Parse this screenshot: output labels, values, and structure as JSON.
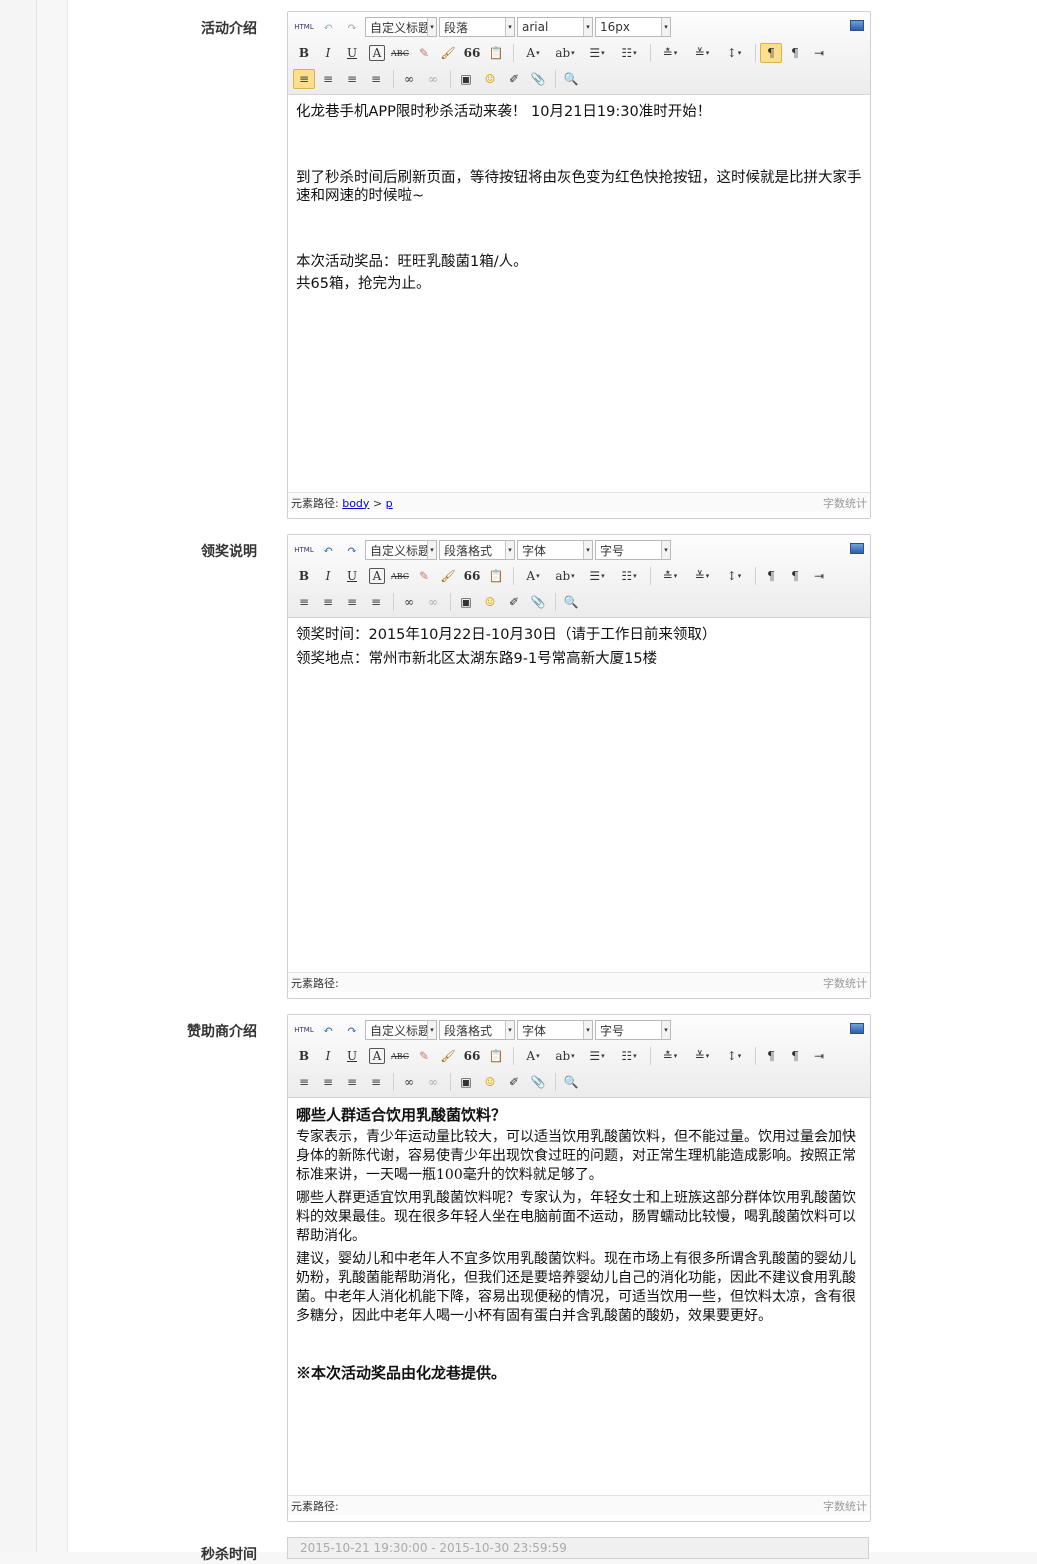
{
  "toolbar": {
    "html_label": "HTML",
    "bold": "B",
    "italic": "I",
    "underline": "U",
    "fontborder": "A",
    "strike": "ABC",
    "forecolor": "A",
    "blockquote": "66",
    "zoom_icon": "search-icon"
  },
  "editors": [
    {
      "label": "活动介绍",
      "combo_heading": "自定义标题",
      "combo_para": "段落",
      "combo_font": "arial",
      "combo_size": "16px",
      "paragraphs": [
        "化龙巷手机APP限时秒杀活动来袭！ 10月21日19:30准时开始！",
        "",
        "到了秒杀时间后刷新页面，等待按钮将由灰色变为红色快抢按钮，这时候就是比拼大家手速和网速的时候啦~",
        "",
        "本次活动奖品：旺旺乳酸菌1箱/人。",
        "共65箱，抢完为止。"
      ],
      "path_label": "元素路径:",
      "path_body": "body",
      "path_sep": ">",
      "path_p": "p",
      "word_count": "字数统计"
    },
    {
      "label": "领奖说明",
      "combo_heading": "自定义标题",
      "combo_para": "段落格式",
      "combo_font": "字体",
      "combo_size": "字号",
      "paragraphs": [
        "领奖时间：2015年10月22日-10月30日（请于工作日前来领取）",
        "领奖地点：常州市新北区太湖东路9-1号常高新大厦15楼"
      ],
      "path_label": "元素路径:",
      "word_count": "字数统计"
    },
    {
      "label": "赞助商介绍",
      "combo_heading": "自定义标题",
      "combo_para": "段落格式",
      "combo_font": "字体",
      "combo_size": "字号",
      "heading": "哪些人群适合饮用乳酸菌饮料？",
      "paragraphs": [
        "专家表示，青少年运动量比较大，可以适当饮用乳酸菌饮料，但不能过量。饮用过量会加快身体的新陈代谢，容易使青少年出现饮食过旺的问题，对正常生理机能造成影响。按照正常标准来讲，一天喝一瓶100毫升的饮料就足够了。",
        "哪些人群更适宜饮用乳酸菌饮料呢？专家认为，年轻女士和上班族这部分群体饮用乳酸菌饮料的效果最佳。现在很多年轻人坐在电脑前面不运动，肠胃蠕动比较慢，喝乳酸菌饮料可以帮助消化。",
        "建议，婴幼儿和中老年人不宜多饮用乳酸菌饮料。现在市场上有很多所谓含乳酸菌的婴幼儿奶粉，乳酸菌能帮助消化，但我们还是要培养婴幼儿自己的消化功能，因此不建议食用乳酸菌。中老年人消化机能下降，容易出现便秘的情况，可适当饮用一些，但饮料太凉，含有很多糖分，因此中老年人喝一小杯有固有蛋白并含乳酸菌的酸奶，效果要更好。"
      ],
      "footer_note": "※本次活动奖品由化龙巷提供。",
      "path_label": "元素路径:",
      "word_count": "字数统计"
    }
  ],
  "seckill": {
    "label": "秒杀时间",
    "value": "2015-10-21 19:30:00 - 2015-10-30 23:59:59"
  }
}
